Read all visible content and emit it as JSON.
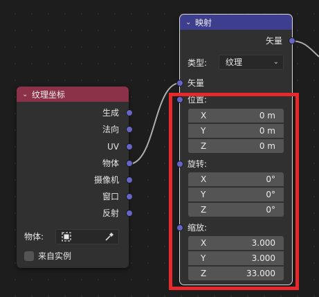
{
  "colors": {
    "texture_coord_header": "#8b3148",
    "mapping_header": "#3e3e8f",
    "socket_vector": "#6565c6",
    "highlight": "#e8292b"
  },
  "texture_coord_node": {
    "title": "纹理坐标",
    "outputs": [
      "生成",
      "法向",
      "UV",
      "物体",
      "摄像机",
      "窗口",
      "反射"
    ],
    "object_label": "物体:",
    "from_instancer_label": "来自实例",
    "from_instancer_checked": false
  },
  "mapping_node": {
    "title": "映射",
    "output_label": "矢量",
    "type_label": "类型:",
    "type_value": "纹理",
    "vector_input_label": "矢量",
    "location": {
      "label": "位置:",
      "fields": [
        {
          "axis": "X",
          "value": "0 m"
        },
        {
          "axis": "Y",
          "value": "0 m"
        },
        {
          "axis": "Z",
          "value": "0 m"
        }
      ]
    },
    "rotation": {
      "label": "旋转:",
      "fields": [
        {
          "axis": "X",
          "value": "0°"
        },
        {
          "axis": "Y",
          "value": "0°"
        },
        {
          "axis": "Z",
          "value": "0°"
        }
      ]
    },
    "scale": {
      "label": "缩放:",
      "fields": [
        {
          "axis": "X",
          "value": "3.000"
        },
        {
          "axis": "Y",
          "value": "3.000"
        },
        {
          "axis": "Z",
          "value": "33.000"
        }
      ]
    }
  }
}
